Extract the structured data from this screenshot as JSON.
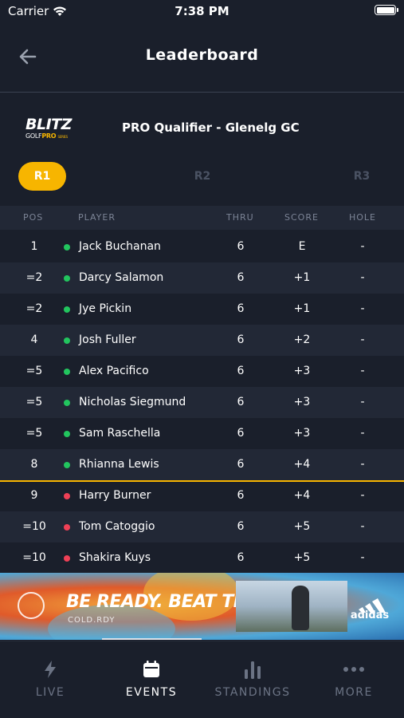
{
  "status_bar": {
    "carrier": "Carrier",
    "time": "7:38 PM"
  },
  "header": {
    "title": "Leaderboard"
  },
  "event": {
    "logo": {
      "main": "BLITZ",
      "sub_golf": "GOLF",
      "sub_pro": "PRO",
      "sub_series": "SERIES"
    },
    "name": "PRO Qualifier - Glenelg GC"
  },
  "rounds": [
    {
      "label": "R1",
      "active": true
    },
    {
      "label": "R2",
      "active": false
    },
    {
      "label": "R3",
      "active": false
    }
  ],
  "table": {
    "columns": {
      "pos": "POS",
      "player": "PLAYER",
      "thru": "THRU",
      "score": "SCORE",
      "hole": "HOLE"
    },
    "rows": [
      {
        "pos": "1",
        "status": "green",
        "player": "Jack Buchanan",
        "thru": "6",
        "score": "E",
        "hole": "-"
      },
      {
        "pos": "=2",
        "status": "green",
        "player": "Darcy Salamon",
        "thru": "6",
        "score": "+1",
        "hole": "-"
      },
      {
        "pos": "=2",
        "status": "green",
        "player": "Jye Pickin",
        "thru": "6",
        "score": "+1",
        "hole": "-"
      },
      {
        "pos": "4",
        "status": "green",
        "player": "Josh Fuller",
        "thru": "6",
        "score": "+2",
        "hole": "-"
      },
      {
        "pos": "=5",
        "status": "green",
        "player": "Alex Pacifico",
        "thru": "6",
        "score": "+3",
        "hole": "-"
      },
      {
        "pos": "=5",
        "status": "green",
        "player": "Nicholas Siegmund",
        "thru": "6",
        "score": "+3",
        "hole": "-"
      },
      {
        "pos": "=5",
        "status": "green",
        "player": "Sam Raschella",
        "thru": "6",
        "score": "+3",
        "hole": "-"
      },
      {
        "pos": "8",
        "status": "green",
        "player": "Rhianna Lewis",
        "thru": "6",
        "score": "+4",
        "hole": "-"
      },
      {
        "pos": "9",
        "status": "red",
        "player": "Harry Burner",
        "thru": "6",
        "score": "+4",
        "hole": "-"
      },
      {
        "pos": "=10",
        "status": "red",
        "player": "Tom Catoggio",
        "thru": "6",
        "score": "+5",
        "hole": "-"
      },
      {
        "pos": "=10",
        "status": "red",
        "player": "Shakira Kuys",
        "thru": "6",
        "score": "+5",
        "hole": "-"
      }
    ]
  },
  "ad": {
    "headline": "BE READY. BEAT THE COLD.",
    "subline": "COLD.RDY",
    "brand": "adidas"
  },
  "tabs": [
    {
      "label": "LIVE",
      "icon": "bolt-icon",
      "active": false
    },
    {
      "label": "EVENTS",
      "icon": "calendar-icon",
      "active": true
    },
    {
      "label": "STANDINGS",
      "icon": "bar-chart-icon",
      "active": false
    },
    {
      "label": "MORE",
      "icon": "more-dots-icon",
      "active": false
    }
  ],
  "colors": {
    "accent": "#f7b500",
    "status_green": "#22c55e",
    "status_red": "#ef4056",
    "background": "#1a1f2b"
  }
}
